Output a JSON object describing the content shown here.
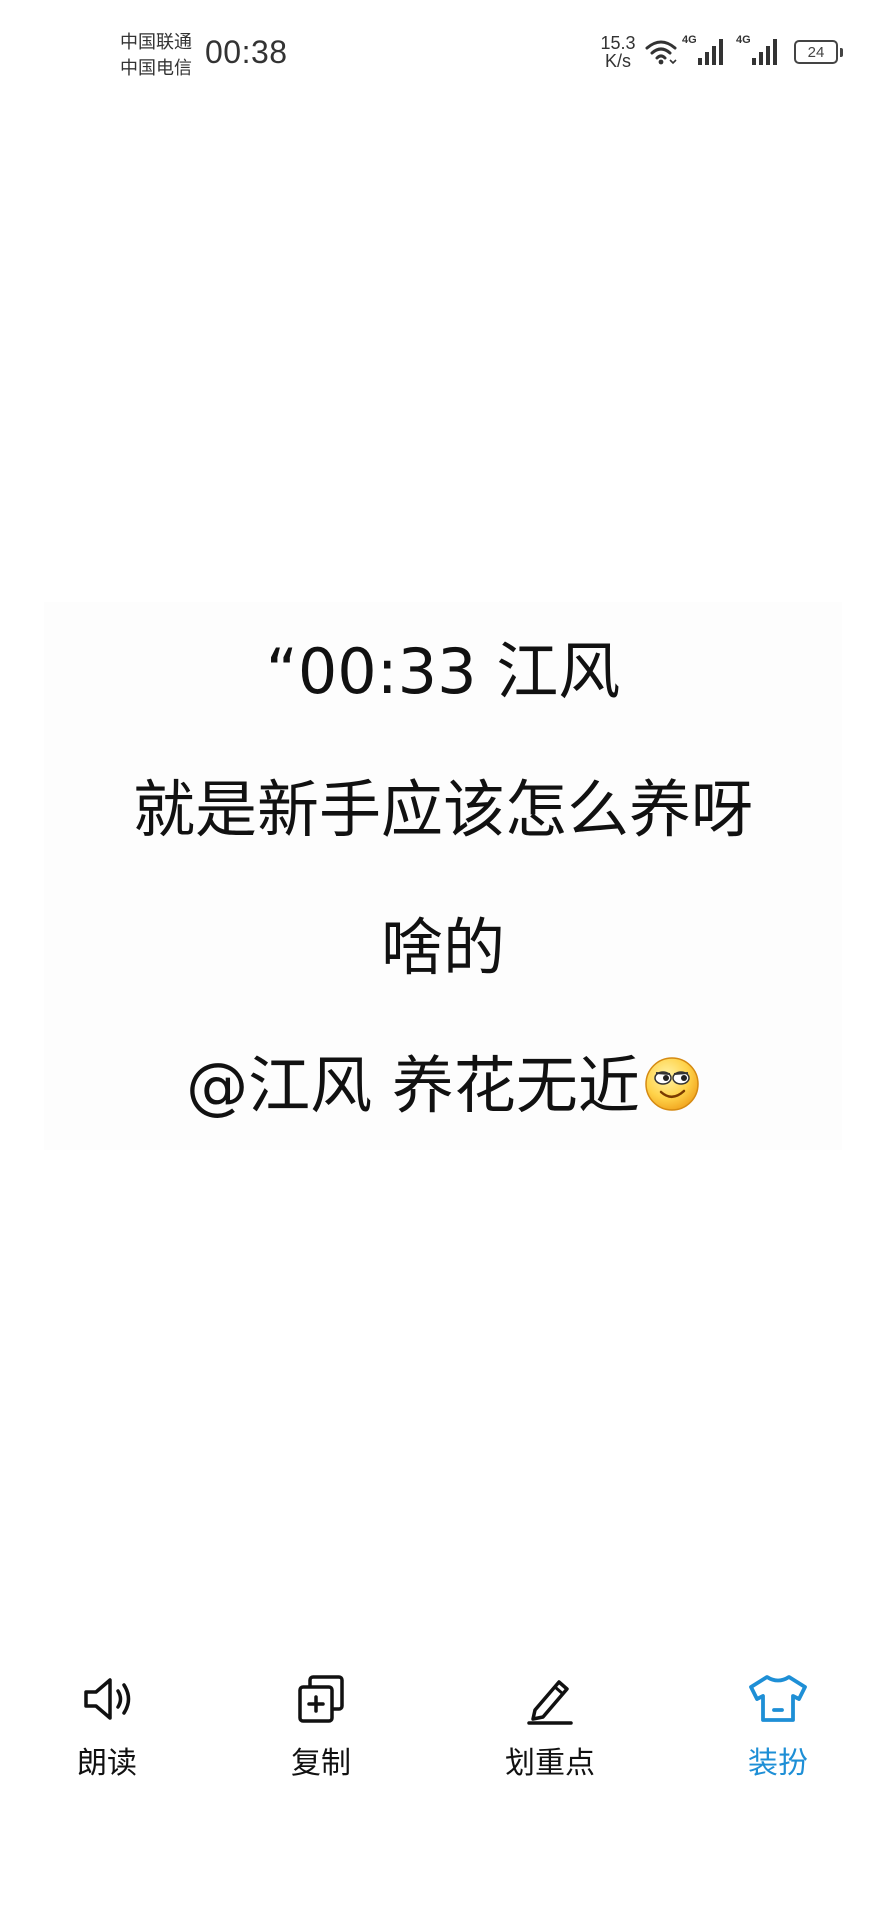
{
  "status_bar": {
    "carrier_1": "中国联通",
    "carrier_2": "中国电信",
    "time": "00:38",
    "net_speed_value": "15.3",
    "net_speed_unit": "K/s",
    "signal_1_label": "4G",
    "signal_2_label": "4G",
    "battery": "24"
  },
  "quote": {
    "line_1": "“00:33 江风",
    "line_2": "就是新手应该怎么养呀",
    "line_3": "啥的",
    "line_4": "@江风 养花无近"
  },
  "toolbar": {
    "read_aloud": "朗读",
    "copy": "复制",
    "highlight": "划重点",
    "dress_up": "装扮",
    "active_color": "#1e8fd6"
  }
}
